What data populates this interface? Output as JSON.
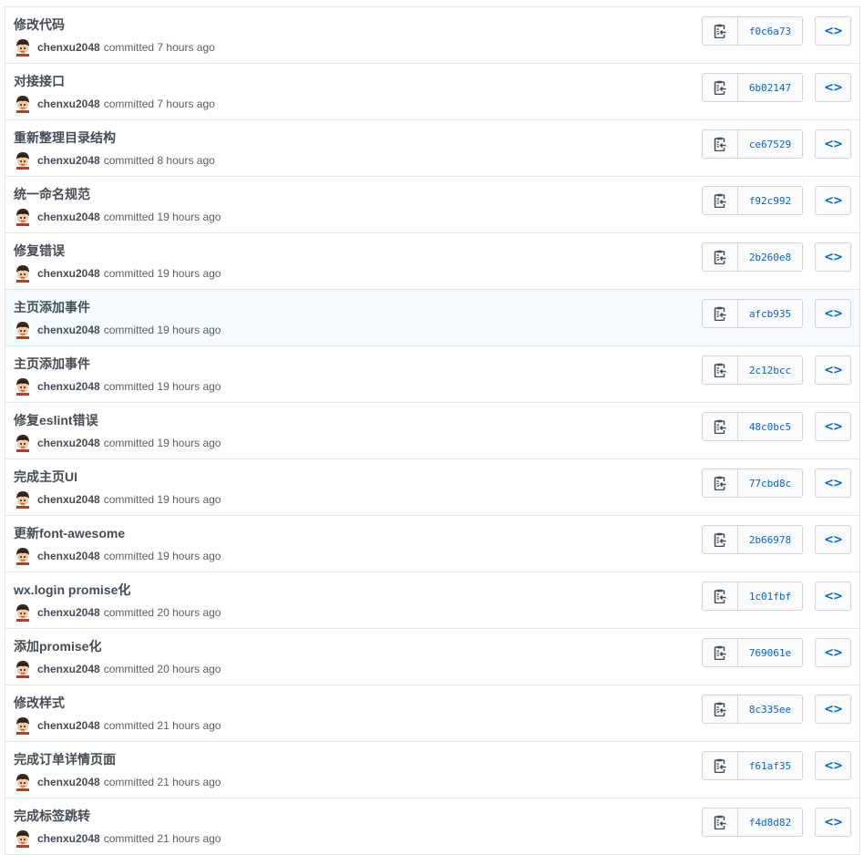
{
  "commits": [
    {
      "title": "修改代码",
      "author": "chenxu2048",
      "verb": "committed",
      "time": "7 hours ago",
      "sha": "f0c6a73"
    },
    {
      "title": "对接接口",
      "author": "chenxu2048",
      "verb": "committed",
      "time": "7 hours ago",
      "sha": "6b02147"
    },
    {
      "title": "重新整理目录结构",
      "author": "chenxu2048",
      "verb": "committed",
      "time": "8 hours ago",
      "sha": "ce67529"
    },
    {
      "title": "统一命名规范",
      "author": "chenxu2048",
      "verb": "committed",
      "time": "19 hours ago",
      "sha": "f92c992"
    },
    {
      "title": "修复错误",
      "author": "chenxu2048",
      "verb": "committed",
      "time": "19 hours ago",
      "sha": "2b260e8"
    },
    {
      "title": "主页添加事件",
      "author": "chenxu2048",
      "verb": "committed",
      "time": "19 hours ago",
      "sha": "afcb935"
    },
    {
      "title": "主页添加事件",
      "author": "chenxu2048",
      "verb": "committed",
      "time": "19 hours ago",
      "sha": "2c12bcc"
    },
    {
      "title": "修复eslint错误",
      "author": "chenxu2048",
      "verb": "committed",
      "time": "19 hours ago",
      "sha": "48c0bc5"
    },
    {
      "title": "完成主页UI",
      "author": "chenxu2048",
      "verb": "committed",
      "time": "19 hours ago",
      "sha": "77cbd8c"
    },
    {
      "title": "更新font-awesome",
      "author": "chenxu2048",
      "verb": "committed",
      "time": "19 hours ago",
      "sha": "2b66978"
    },
    {
      "title": "wx.login promise化",
      "author": "chenxu2048",
      "verb": "committed",
      "time": "20 hours ago",
      "sha": "1c01fbf"
    },
    {
      "title": "添加promise化",
      "author": "chenxu2048",
      "verb": "committed",
      "time": "20 hours ago",
      "sha": "769061e"
    },
    {
      "title": "修改样式",
      "author": "chenxu2048",
      "verb": "committed",
      "time": "21 hours ago",
      "sha": "8c335ee"
    },
    {
      "title": "完成订单详情页面",
      "author": "chenxu2048",
      "verb": "committed",
      "time": "21 hours ago",
      "sha": "f61af35"
    },
    {
      "title": "完成标签跳转",
      "author": "chenxu2048",
      "verb": "committed",
      "time": "21 hours ago",
      "sha": "f4d8d82"
    }
  ],
  "highlighted_row": 5,
  "icons": {
    "copy": "clipboard-icon",
    "browse": "code-brackets-icon",
    "avatar": "avatar"
  },
  "colors": {
    "sha": "#0366d6",
    "border": "#d1d5da",
    "hover_row": "#f6fbff"
  }
}
